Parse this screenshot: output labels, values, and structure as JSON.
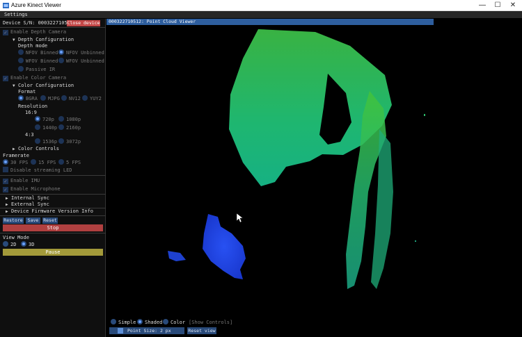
{
  "window": {
    "title": "Azure Kinect Viewer",
    "minimize": "—",
    "maximize": "☐",
    "close": "✕"
  },
  "menu": {
    "settings": "Settings"
  },
  "device": {
    "sn_label": "Device S/N: 000322710512",
    "close_button": "Close device"
  },
  "depth": {
    "enable_label": "Enable Depth Camera",
    "config_label": "Depth Configuration",
    "mode_label": "Depth mode",
    "modes": [
      "NFOV Binned",
      "NFOV Unbinned",
      "WFOV Binned",
      "WFOV Unbinned",
      "Passive IR"
    ],
    "selected_mode": "NFOV Unbinned"
  },
  "color": {
    "enable_label": "Enable Color Camera",
    "config_label": "Color Configuration",
    "format_label": "Format",
    "formats": [
      "BGRA",
      "MJPG",
      "NV12",
      "YUY2"
    ],
    "selected_format": "BGRA",
    "resolution_label": "Resolution",
    "ratio_169": "16:9",
    "res_169": [
      "720p",
      "1080p",
      "1440p",
      "2160p"
    ],
    "ratio_43": "4:3",
    "res_43": [
      "1536p",
      "3072p"
    ],
    "selected_res": "720p",
    "controls_label": "Color Controls"
  },
  "framerate": {
    "label": "Framerate",
    "options": [
      "30 FPS",
      "15 FPS",
      "5 FPS"
    ],
    "selected": "30 FPS"
  },
  "streaming_led": "Disable streaming LED",
  "imu": "Enable IMU",
  "microphone": "Enable Microphone",
  "sections": {
    "internal_sync": "Internal Sync",
    "external_sync": "External Sync",
    "firmware": "Device Firmware Version Info"
  },
  "actions": {
    "restore": "Restore",
    "save": "Save",
    "reset": "Reset",
    "stop": "Stop",
    "pause": "Pause"
  },
  "view_mode": {
    "label": "View Mode",
    "options": [
      "2D",
      "3D"
    ],
    "selected": "3D"
  },
  "viewer": {
    "header": "000322710512: Point Cloud Viewer",
    "render_modes": [
      "Simple",
      "Shaded",
      "Color"
    ],
    "selected_render": "Shaded",
    "show_controls": "[Show Controls]",
    "point_size": "Point Size: 2 px",
    "reset_view": "Reset view"
  },
  "colors": {
    "accent": "#294a7a",
    "header": "#2e5e9e",
    "stop": "#b04040",
    "pause": "#a39a3a",
    "close_device": "#c44848"
  }
}
